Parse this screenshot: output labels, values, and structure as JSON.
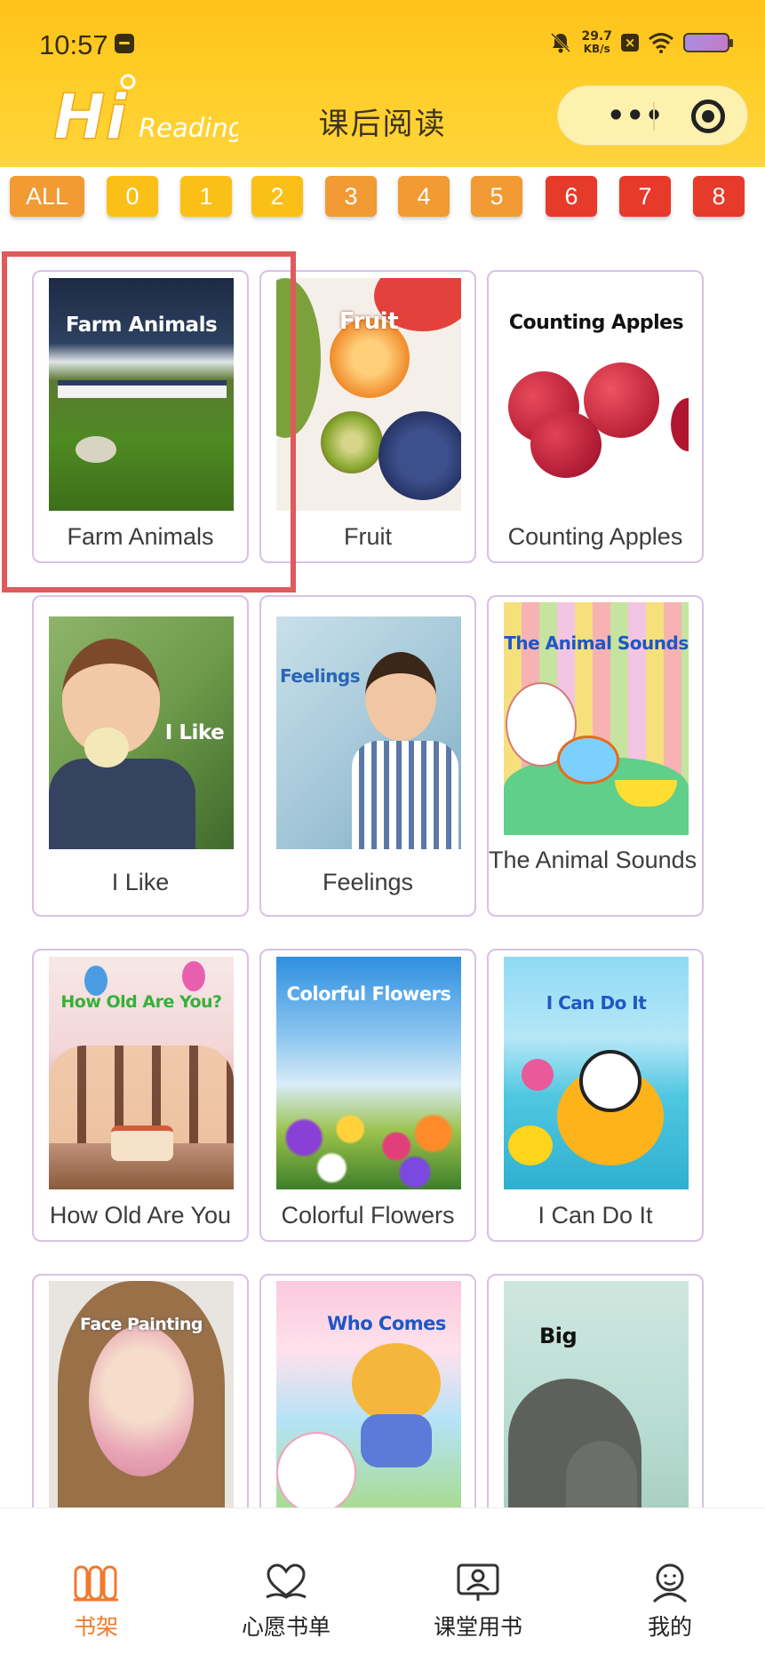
{
  "status_bar": {
    "time": "10:57",
    "net_speed_value": "29.7",
    "net_speed_unit": "KB/s"
  },
  "header": {
    "logo_hi": "Hi",
    "logo_reading": "Reading",
    "title": "课后阅读",
    "menu_icon": "more-dots-icon",
    "close_icon": "target-circle-icon"
  },
  "colors": {
    "header_bg": "#ffc91f",
    "accent": "#f07a2c",
    "highlight": "#e0595b",
    "card_border": "#d7c1e6"
  },
  "filters": [
    {
      "label": "ALL",
      "color": "#f29a33"
    },
    {
      "label": "0",
      "color": "#fbc018"
    },
    {
      "label": "1",
      "color": "#fbc018"
    },
    {
      "label": "2",
      "color": "#fbc018"
    },
    {
      "label": "3",
      "color": "#f29a33"
    },
    {
      "label": "4",
      "color": "#f29a33"
    },
    {
      "label": "5",
      "color": "#f29a33"
    },
    {
      "label": "6",
      "color": "#e63a2b"
    },
    {
      "label": "7",
      "color": "#e63a2b"
    },
    {
      "label": "8",
      "color": "#e63a2b"
    }
  ],
  "books": [
    {
      "title": "Farm Animals",
      "cover_text": "Farm Animals"
    },
    {
      "title": "Fruit",
      "cover_text": "Fruit"
    },
    {
      "title": "Counting Apples",
      "cover_text": "Counting Apples"
    },
    {
      "title": "I Like",
      "cover_text": "I Like"
    },
    {
      "title": "Feelings",
      "cover_text": "Feelings"
    },
    {
      "title": "The Animal Sounds",
      "cover_text": "The Animal Sounds"
    },
    {
      "title": "How Old Are You",
      "cover_text": "How Old Are You?"
    },
    {
      "title": "Colorful Flowers",
      "cover_text": "Colorful Flowers"
    },
    {
      "title": "I Can Do It",
      "cover_text": "I Can Do It"
    },
    {
      "title": "",
      "cover_text": "Face Painting"
    },
    {
      "title": "",
      "cover_text": "Who Comes"
    },
    {
      "title": "",
      "cover_text": "Big"
    }
  ],
  "bottom_nav": [
    {
      "label": "书架",
      "icon": "bookshelf-icon",
      "active": true
    },
    {
      "label": "心愿书单",
      "icon": "wishlist-heart-icon",
      "active": false
    },
    {
      "label": "课堂用书",
      "icon": "classroom-book-icon",
      "active": false
    },
    {
      "label": "我的",
      "icon": "profile-face-icon",
      "active": false
    }
  ]
}
